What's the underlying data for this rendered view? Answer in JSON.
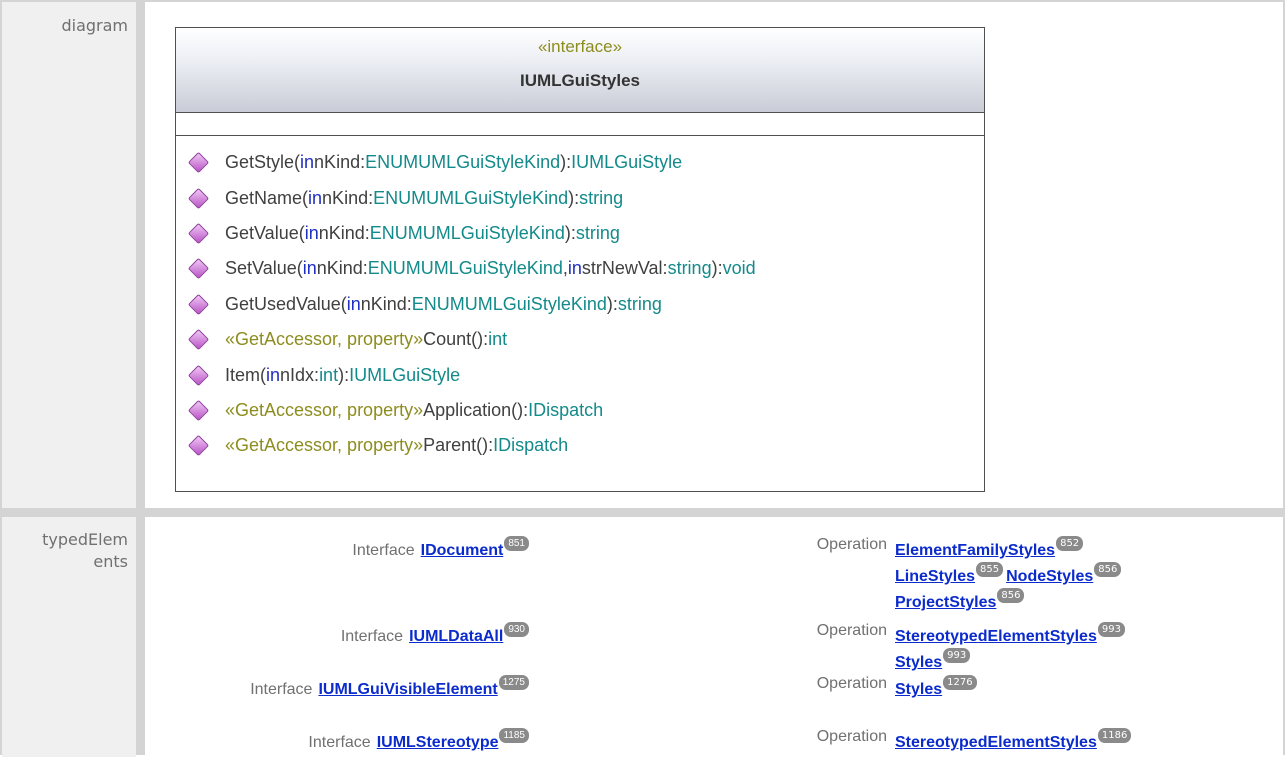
{
  "rows": {
    "diagram_label": "diagram",
    "typed_elements_label_line1": "typedElem",
    "typed_elements_label_line2": "ents"
  },
  "uml": {
    "stereotype": "«interface»",
    "name": "IUMLGuiStyles",
    "operations": [
      {
        "parts": [
          [
            "n",
            "GetStyle("
          ],
          [
            "k",
            "in"
          ],
          [
            "n",
            " nKind:"
          ],
          [
            "t",
            "ENUMUMLGuiStyleKind"
          ],
          [
            "n",
            "):"
          ],
          [
            "t",
            "IUMLGuiStyle"
          ]
        ]
      },
      {
        "parts": [
          [
            "n",
            "GetName("
          ],
          [
            "k",
            "in"
          ],
          [
            "n",
            " nKind:"
          ],
          [
            "t",
            "ENUMUMLGuiStyleKind"
          ],
          [
            "n",
            "):"
          ],
          [
            "t",
            "string"
          ]
        ]
      },
      {
        "parts": [
          [
            "n",
            "GetValue("
          ],
          [
            "k",
            "in"
          ],
          [
            "n",
            " nKind:"
          ],
          [
            "t",
            "ENUMUMLGuiStyleKind"
          ],
          [
            "n",
            "):"
          ],
          [
            "t",
            "string"
          ]
        ]
      },
      {
        "parts": [
          [
            "n",
            "SetValue("
          ],
          [
            "k",
            "in"
          ],
          [
            "n",
            " nKind:"
          ],
          [
            "t",
            "ENUMUMLGuiStyleKind"
          ],
          [
            "n",
            ", "
          ],
          [
            "k",
            "in"
          ],
          [
            "n",
            " strNewVal:"
          ],
          [
            "t",
            "string"
          ],
          [
            "n",
            "):"
          ],
          [
            "t",
            "void"
          ]
        ]
      },
      {
        "parts": [
          [
            "n",
            "GetUsedValue("
          ],
          [
            "k",
            "in"
          ],
          [
            "n",
            " nKind:"
          ],
          [
            "t",
            "ENUMUMLGuiStyleKind"
          ],
          [
            "n",
            "):"
          ],
          [
            "t",
            "string"
          ]
        ]
      },
      {
        "parts": [
          [
            "s",
            "«GetAccessor, property»"
          ],
          [
            "n",
            " Count():"
          ],
          [
            "t",
            "int"
          ]
        ]
      },
      {
        "parts": [
          [
            "n",
            "Item("
          ],
          [
            "k",
            "in"
          ],
          [
            "n",
            " nIdx:"
          ],
          [
            "t",
            "int"
          ],
          [
            "n",
            "):"
          ],
          [
            "t",
            "IUMLGuiStyle"
          ]
        ]
      },
      {
        "parts": [
          [
            "s",
            "«GetAccessor, property»"
          ],
          [
            "n",
            " Application():"
          ],
          [
            "t",
            "IDispatch"
          ]
        ]
      },
      {
        "parts": [
          [
            "s",
            "«GetAccessor, property»"
          ],
          [
            "n",
            " Parent():"
          ],
          [
            "t",
            "IDispatch"
          ]
        ]
      }
    ]
  },
  "typed_elements": {
    "left": [
      {
        "kind": "Interface",
        "name": "IDocument",
        "badge": "851"
      },
      {
        "kind": "Interface",
        "name": "IUMLDataAll",
        "badge": "930"
      },
      {
        "kind": "Interface",
        "name": "IUMLGuiVisibleElement",
        "badge": "1275"
      },
      {
        "kind": "Interface",
        "name": "IUMLStereotype",
        "badge": "1185"
      }
    ],
    "right": [
      {
        "kind": "Operation",
        "refs": [
          [
            {
              "name": "ElementFamilyStyles",
              "badge": "852"
            }
          ],
          [
            {
              "name": "LineStyles",
              "badge": "855"
            },
            {
              "name": "NodeStyles",
              "badge": "856"
            }
          ],
          [
            {
              "name": "ProjectStyles",
              "badge": "856"
            }
          ]
        ]
      },
      {
        "kind": "Operation",
        "refs": [
          [
            {
              "name": "StereotypedElementStyles",
              "badge": "993"
            }
          ],
          [
            {
              "name": "Styles",
              "badge": "993"
            }
          ]
        ]
      },
      {
        "kind": "Operation",
        "refs": [
          [
            {
              "name": "Styles",
              "badge": "1276"
            }
          ]
        ]
      },
      {
        "kind": "Operation",
        "refs": [
          [
            {
              "name": "StereotypedElementStyles",
              "badge": "1186"
            }
          ]
        ]
      }
    ]
  }
}
